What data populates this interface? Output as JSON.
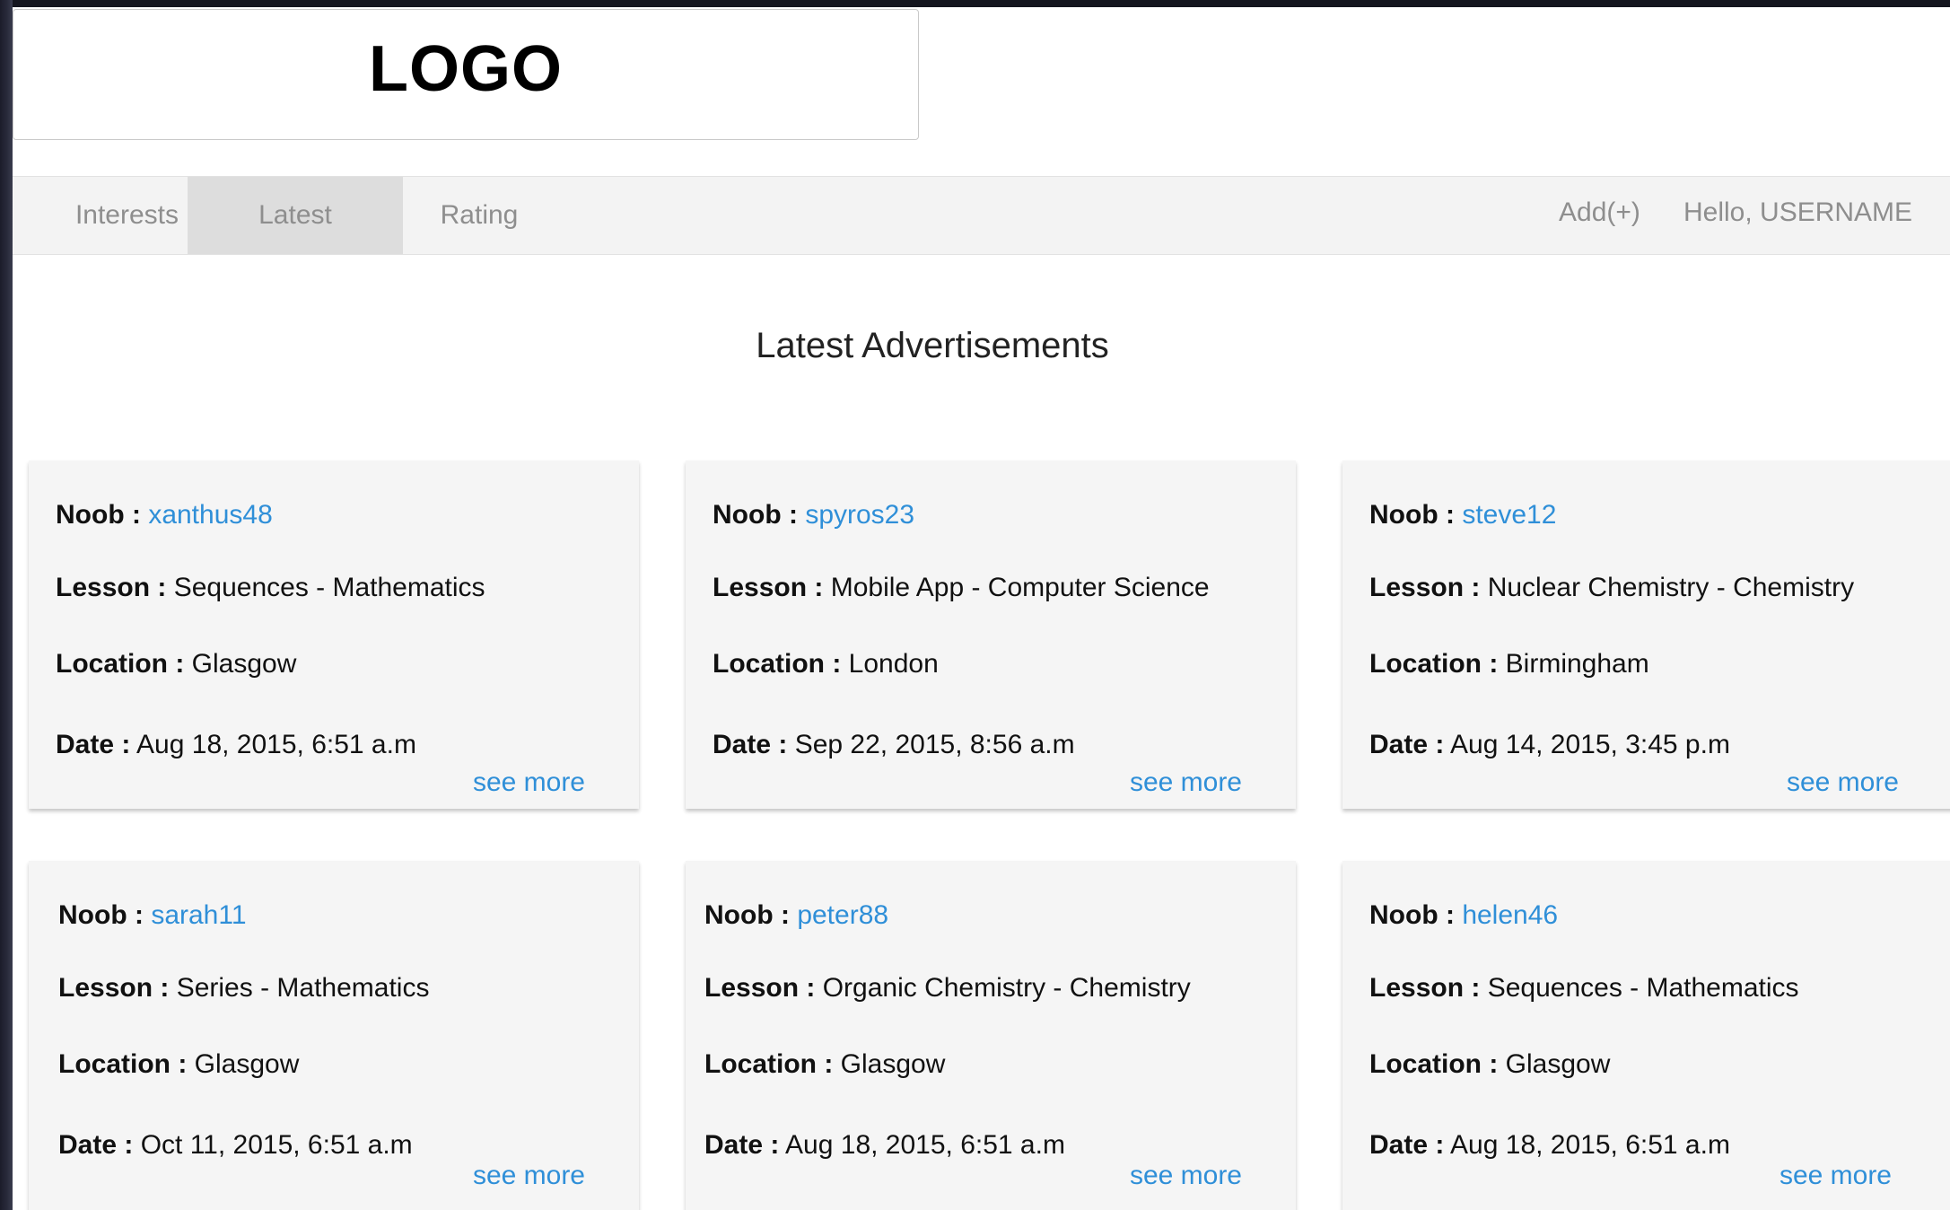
{
  "logo": {
    "text": "LOGO"
  },
  "nav": {
    "tabs": [
      {
        "label": "Interests"
      },
      {
        "label": "Latest"
      },
      {
        "label": "Rating"
      }
    ],
    "add_label": "Add(+)",
    "greeting": "Hello, USERNAME"
  },
  "page": {
    "heading": "Latest Advertisements"
  },
  "labels": {
    "noob": "Noob :",
    "lesson": "Lesson :",
    "location": "Location :",
    "date": "Date :",
    "see_more": "see more"
  },
  "ads": [
    {
      "noob": "xanthus48",
      "lesson": "Sequences - Mathematics",
      "location": "Glasgow",
      "date": "Aug 18, 2015, 6:51 a.m"
    },
    {
      "noob": "spyros23",
      "lesson": "Mobile App - Computer Science",
      "location": "London",
      "date": "Sep 22, 2015, 8:56 a.m"
    },
    {
      "noob": "steve12",
      "lesson": "Nuclear Chemistry - Chemistry",
      "location": "Birmingham",
      "date": "Aug 14, 2015, 3:45 p.m"
    },
    {
      "noob": "sarah11",
      "lesson": "Series - Mathematics",
      "location": "Glasgow",
      "date": "Oct 11, 2015, 6:51 a.m"
    },
    {
      "noob": "peter88",
      "lesson": "Organic Chemistry - Chemistry",
      "location": "Glasgow",
      "date": "Aug 18, 2015, 6:51 a.m"
    },
    {
      "noob": "helen46",
      "lesson": "Sequences - Mathematics",
      "location": "Glasgow",
      "date": "Aug 18, 2015, 6:51 a.m"
    }
  ],
  "colors": {
    "link": "#2f8fd8",
    "nav_bg": "#f3f3f3",
    "active_tab": "#dddddd",
    "card_bg": "#f5f5f5"
  }
}
